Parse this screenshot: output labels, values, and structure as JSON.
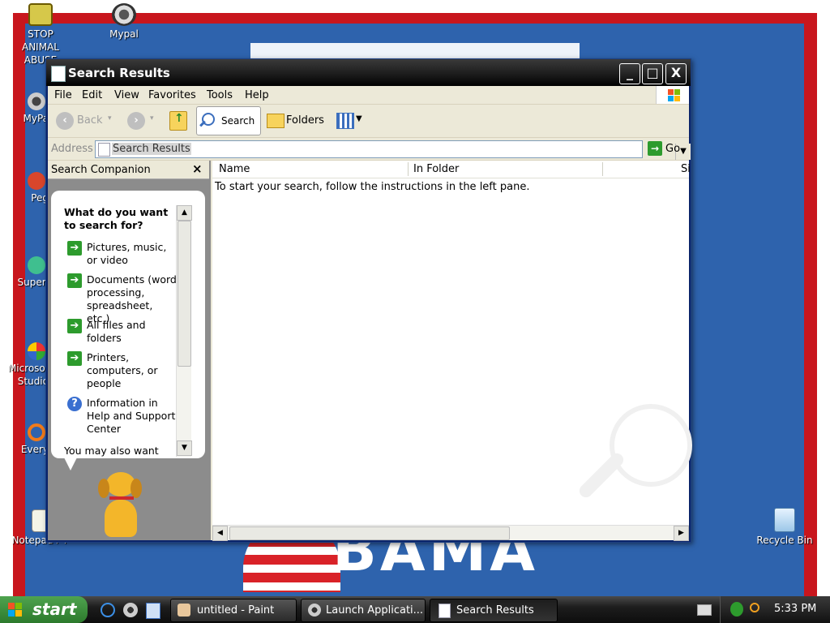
{
  "desktop": {
    "background_text": "BAMA",
    "icons": [
      {
        "id": "stop-animal-abuse",
        "label_line1": "STOP ANIMAL",
        "label_line2": "ABUSE"
      },
      {
        "id": "mypal-top",
        "label_line1": "Mypal"
      },
      {
        "id": "mypal-left",
        "label_line1": "MyPa"
      },
      {
        "id": "peg",
        "label_line1": "Peg"
      },
      {
        "id": "super",
        "label_line1": "Superi"
      },
      {
        "id": "microsoft-studio",
        "label_line1": "Microsof",
        "label_line2": "Studio"
      },
      {
        "id": "every",
        "label_line1": "Every"
      },
      {
        "id": "notepadpp",
        "label_line1": "Notepad++"
      },
      {
        "id": "recycle-bin",
        "label_line1": "Recycle Bin"
      }
    ]
  },
  "window": {
    "title": "Search Results",
    "controls": {
      "minimize": "_",
      "maximize": "□",
      "close": "X"
    },
    "menu": [
      "File",
      "Edit",
      "View",
      "Favorites",
      "Tools",
      "Help"
    ],
    "toolbar": {
      "back_label": "Back",
      "search_label": "Search",
      "folders_label": "Folders"
    },
    "address": {
      "label": "Address",
      "value": "Search Results",
      "go_label": "Go"
    },
    "left_pane": {
      "title": "Search Companion",
      "close": "×",
      "question": "What do you want to search for?",
      "options": [
        "Pictures, music, or video",
        "Documents (word processing, spreadsheet, etc.)",
        "All files and folders",
        "Printers, computers, or people",
        "Information in Help and Support Center"
      ],
      "footer": "You may also want"
    },
    "right_pane": {
      "columns": [
        "Name",
        "In Folder",
        "Si"
      ],
      "message": "To start your search, follow the instructions in the left pane."
    }
  },
  "taskbar": {
    "start_label": "start",
    "tasks": [
      "untitled - Paint",
      "Launch Applicati...",
      "Search Results"
    ],
    "clock": "5:33 PM"
  }
}
